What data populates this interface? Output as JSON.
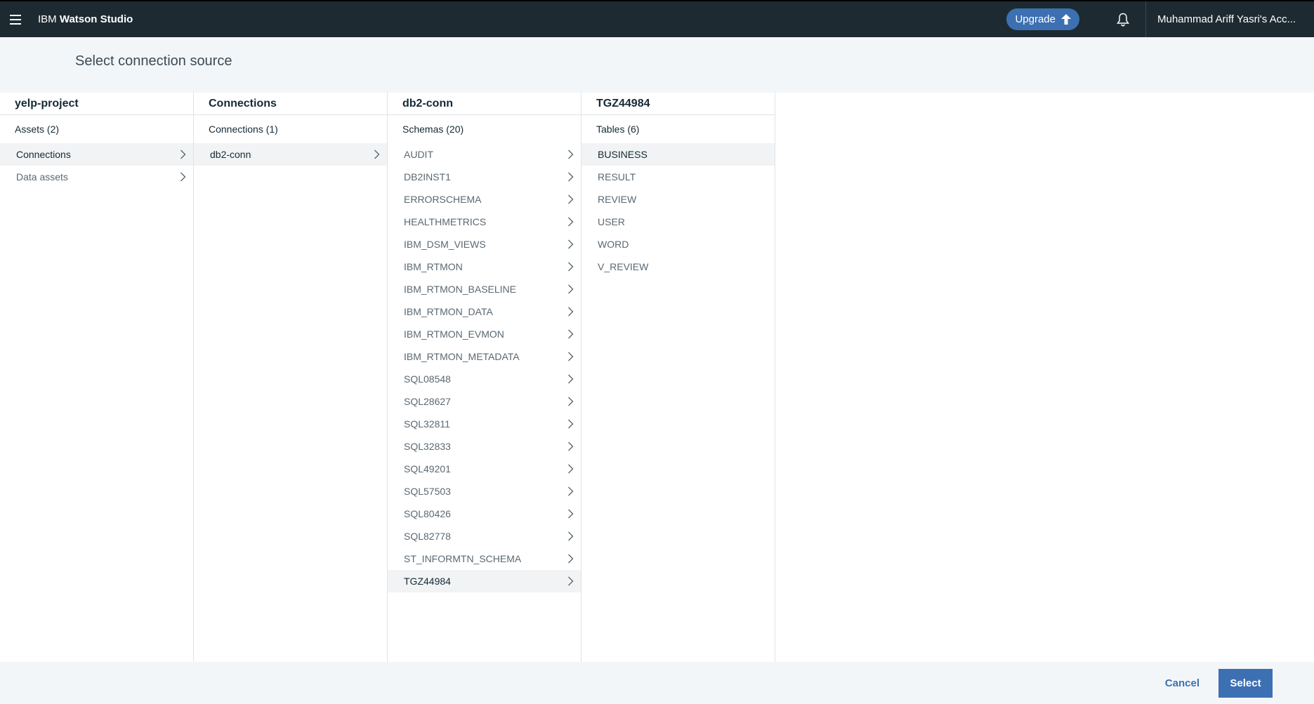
{
  "header": {
    "brand_prefix": "IBM",
    "brand_name": "Watson Studio",
    "upgrade_label": "Upgrade",
    "account_name": "Muhammad Ariff Yasri's Acc..."
  },
  "page": {
    "title": "Select connection source"
  },
  "columns": [
    {
      "title": "yelp-project",
      "subtitle": "Assets (2)",
      "items": [
        {
          "label": "Connections",
          "has_children": true,
          "selected": true
        },
        {
          "label": "Data assets",
          "has_children": true,
          "selected": false
        }
      ]
    },
    {
      "title": "Connections",
      "subtitle": "Connections (1)",
      "items": [
        {
          "label": "db2-conn",
          "has_children": true,
          "selected": true
        }
      ]
    },
    {
      "title": "db2-conn",
      "subtitle": "Schemas (20)",
      "items": [
        {
          "label": "AUDIT",
          "has_children": true,
          "selected": false
        },
        {
          "label": "DB2INST1",
          "has_children": true,
          "selected": false
        },
        {
          "label": "ERRORSCHEMA",
          "has_children": true,
          "selected": false
        },
        {
          "label": "HEALTHMETRICS",
          "has_children": true,
          "selected": false
        },
        {
          "label": "IBM_DSM_VIEWS",
          "has_children": true,
          "selected": false
        },
        {
          "label": "IBM_RTMON",
          "has_children": true,
          "selected": false
        },
        {
          "label": "IBM_RTMON_BASELINE",
          "has_children": true,
          "selected": false
        },
        {
          "label": "IBM_RTMON_DATA",
          "has_children": true,
          "selected": false
        },
        {
          "label": "IBM_RTMON_EVMON",
          "has_children": true,
          "selected": false
        },
        {
          "label": "IBM_RTMON_METADATA",
          "has_children": true,
          "selected": false
        },
        {
          "label": "SQL08548",
          "has_children": true,
          "selected": false
        },
        {
          "label": "SQL28627",
          "has_children": true,
          "selected": false
        },
        {
          "label": "SQL32811",
          "has_children": true,
          "selected": false
        },
        {
          "label": "SQL32833",
          "has_children": true,
          "selected": false
        },
        {
          "label": "SQL49201",
          "has_children": true,
          "selected": false
        },
        {
          "label": "SQL57503",
          "has_children": true,
          "selected": false
        },
        {
          "label": "SQL80426",
          "has_children": true,
          "selected": false
        },
        {
          "label": "SQL82778",
          "has_children": true,
          "selected": false
        },
        {
          "label": "ST_INFORMTN_SCHEMA",
          "has_children": true,
          "selected": false
        },
        {
          "label": "TGZ44984",
          "has_children": true,
          "selected": true
        }
      ]
    },
    {
      "title": "TGZ44984",
      "subtitle": "Tables (6)",
      "items": [
        {
          "label": "BUSINESS",
          "has_children": false,
          "selected": true
        },
        {
          "label": "RESULT",
          "has_children": false,
          "selected": false
        },
        {
          "label": "REVIEW",
          "has_children": false,
          "selected": false
        },
        {
          "label": "USER",
          "has_children": false,
          "selected": false
        },
        {
          "label": "WORD",
          "has_children": false,
          "selected": false
        },
        {
          "label": "V_REVIEW",
          "has_children": false,
          "selected": false
        }
      ]
    }
  ],
  "footer": {
    "cancel_label": "Cancel",
    "select_label": "Select"
  },
  "icons": {
    "menu": "hamburger-menu-icon",
    "upgrade": "arrow-up-icon",
    "notifications": "bell-icon",
    "chevron": "chevron-right-icon"
  },
  "colors": {
    "topbar": "#1d2a32",
    "accent": "#3d70b2",
    "background": "#f3f6f9"
  }
}
